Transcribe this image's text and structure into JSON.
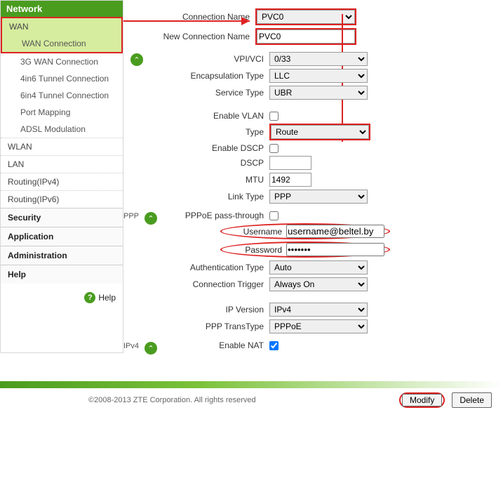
{
  "sidebar": {
    "header": "Network",
    "wan": "WAN",
    "items": [
      "WAN Connection",
      "3G WAN Connection",
      "4in6 Tunnel Connection",
      "6in4 Tunnel Connection",
      "Port Mapping",
      "ADSL Modulation"
    ],
    "groups": [
      "WLAN",
      "LAN",
      "Routing(IPv4)",
      "Routing(IPv6)"
    ],
    "sections": [
      "Security",
      "Application",
      "Administration",
      "Help"
    ],
    "help": "Help"
  },
  "form": {
    "connection_name_label": "Connection Name",
    "connection_name": "PVC0",
    "new_connection_name_label": "New Connection Name",
    "new_connection_name": "PVC0",
    "vpi_vci_label": "VPI/VCI",
    "vpi_vci": "0/33",
    "encapsulation_label": "Encapsulation Type",
    "encapsulation": "LLC",
    "service_type_label": "Service Type",
    "service_type": "UBR",
    "enable_vlan_label": "Enable VLAN",
    "type_label": "Type",
    "type": "Route",
    "enable_dscp_label": "Enable DSCP",
    "dscp_label": "DSCP",
    "dscp": "",
    "mtu_label": "MTU",
    "mtu": "1492",
    "link_type_label": "Link Type",
    "link_type": "PPP",
    "ppp_section": "PPP",
    "pppoe_pass_label": "PPPoE pass-through",
    "username_label": "Username",
    "username": "username@beltel.by",
    "password_label": "Password",
    "password": "•••••••",
    "auth_type_label": "Authentication Type",
    "auth_type": "Auto",
    "conn_trigger_label": "Connection Trigger",
    "conn_trigger": "Always On",
    "ip_version_label": "IP Version",
    "ip_version": "IPv4",
    "ppp_trans_label": "PPP TransType",
    "ppp_trans": "PPPoE",
    "ipv4_section": "IPv4",
    "enable_nat_label": "Enable NAT"
  },
  "footer": {
    "copyright": "©2008-2013 ZTE Corporation. All rights reserved",
    "modify": "Modify",
    "delete": "Delete"
  }
}
